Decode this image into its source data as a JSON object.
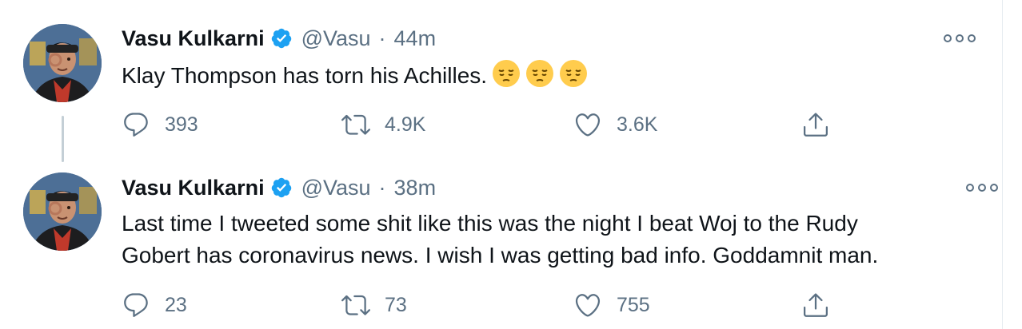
{
  "tweets": [
    {
      "name": "Vasu Kulkarni",
      "handle": "@Vasu",
      "separator": "·",
      "time": "44m",
      "text": "Klay Thompson has torn his Achilles.",
      "emojis": [
        "pensive-face",
        "pensive-face",
        "pensive-face"
      ],
      "replies": "393",
      "retweets": "4.9K",
      "likes": "3.6K"
    },
    {
      "name": "Vasu Kulkarni",
      "handle": "@Vasu",
      "separator": "·",
      "time": "38m",
      "text_lines": [
        "Last time I tweeted some shit like this was the night I beat Woj to the Rudy",
        "Gobert has coronavirus news. I wish I was getting bad info. Goddamnit man."
      ],
      "replies": "23",
      "retweets": "73",
      "likes": "755"
    }
  ],
  "colors": {
    "verified": "#1da1f2",
    "secondary_text": "#5b7083",
    "primary_text": "#0f1419",
    "thread_line": "#c4cfd6"
  },
  "icons": [
    "verified-badge-icon",
    "more-icon",
    "reply-icon",
    "retweet-icon",
    "like-icon",
    "share-icon"
  ]
}
